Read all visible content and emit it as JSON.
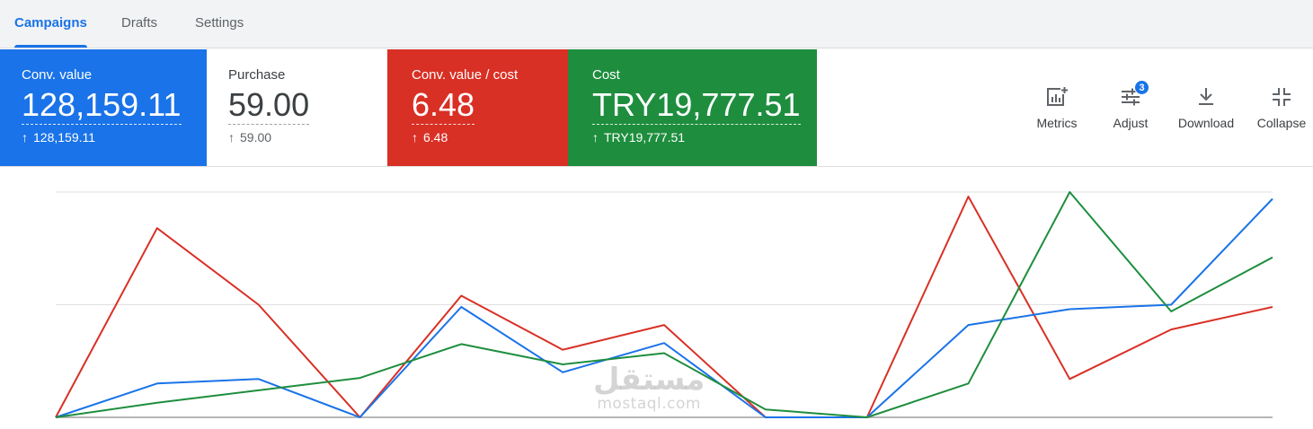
{
  "tabs": [
    {
      "label": "Campaigns",
      "active": true
    },
    {
      "label": "Drafts",
      "active": false
    },
    {
      "label": "Settings",
      "active": false
    }
  ],
  "scorecards": [
    {
      "name": "Conv. value",
      "value": "128,159.11",
      "delta": "128,159.11",
      "color": "#1a73e8"
    },
    {
      "name": "Purchase",
      "value": "59.00",
      "delta": "59.00",
      "color": "#ffffff"
    },
    {
      "name": "Conv. value / cost",
      "value": "6.48",
      "delta": "6.48",
      "color": "#d93025"
    },
    {
      "name": "Cost",
      "value": "TRY19,777.51",
      "delta": "TRY19,777.51",
      "color": "#1e8e3e"
    }
  ],
  "toolbar": {
    "metrics_label": "Metrics",
    "adjust_label": "Adjust",
    "adjust_badge": "3",
    "download_label": "Download",
    "collapse_label": "Collapse"
  },
  "watermark": {
    "arabic": "مستقل",
    "latin": "mostaql.com"
  },
  "chart_data": {
    "type": "line",
    "ylim": [
      0,
      100
    ],
    "grid": true,
    "series": [
      {
        "color": "#d93025",
        "values": [
          0,
          84,
          50,
          0,
          54,
          30,
          41,
          0,
          0,
          98,
          17,
          39,
          49
        ]
      },
      {
        "color": "#1a73e8",
        "values": [
          0,
          15,
          17,
          0,
          49,
          20,
          33,
          0,
          0,
          41,
          48,
          50,
          97
        ]
      },
      {
        "color": "#1e8e3e",
        "values": [
          0,
          6.5,
          12,
          17.5,
          32.5,
          23.5,
          28.5,
          3.5,
          0,
          15,
          100,
          47,
          71
        ]
      }
    ]
  }
}
